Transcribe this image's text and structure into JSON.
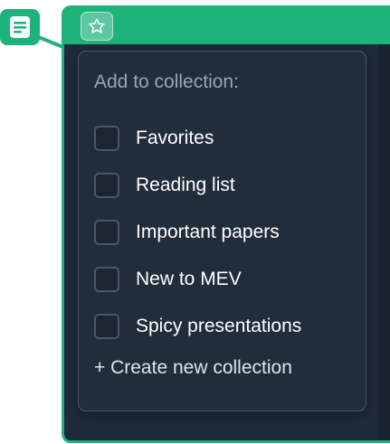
{
  "menu": {
    "title": "Add to collection:",
    "items": [
      {
        "label": "Favorites",
        "checked": false
      },
      {
        "label": "Reading list",
        "checked": false
      },
      {
        "label": "Important papers",
        "checked": false
      },
      {
        "label": "New to MEV",
        "checked": false
      },
      {
        "label": "Spicy presentations",
        "checked": false
      }
    ],
    "create_label": "+ Create new collection"
  },
  "icons": {
    "doc_badge": "document-icon",
    "star_button": "star-icon"
  },
  "colors": {
    "accent": "#1fb37c",
    "card_bg": "#1f2b3a",
    "menu_bg": "#222d3b"
  }
}
